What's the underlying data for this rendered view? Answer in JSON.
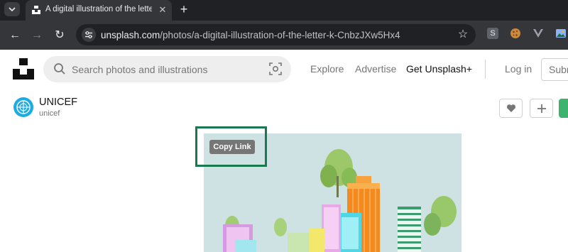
{
  "browser": {
    "tab": {
      "title": "A digital illustration of the letter",
      "close_glyph": "✕"
    },
    "new_tab_glyph": "+",
    "menu_glyph": "⌄",
    "nav": {
      "back": "←",
      "forward": "→",
      "reload": "↻"
    },
    "url": {
      "domain": "unsplash.com",
      "path": "/photos/a-digital-illustration-of-the-letter-k-CnbzJXw5Hx4"
    },
    "bookmark_glyph": "☆",
    "extensions": [
      "S-extension-icon",
      "cookie-icon",
      "vue-icon",
      "image-extension-icon"
    ],
    "ext_s_label": "S"
  },
  "header": {
    "search_placeholder": "Search photos and illustrations",
    "nav_links": [
      "Explore",
      "Advertise",
      "Get Unsplash+"
    ],
    "login": "Log in",
    "submit": "Subm"
  },
  "author": {
    "name": "UNICEF",
    "handle": "unicef"
  },
  "actions": {
    "like_glyph": "♥",
    "add_glyph": "+"
  },
  "tooltip": {
    "copy_link": "Copy Link"
  },
  "colors": {
    "accent_green": "#187a4e",
    "download_green": "#3cb46e",
    "avatar_blue": "#1cabe2",
    "chrome_dark": "#202124"
  }
}
